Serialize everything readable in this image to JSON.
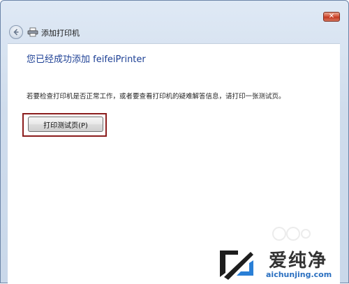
{
  "window": {
    "close_glyph": "✕"
  },
  "nav": {
    "title": "添加打印机"
  },
  "content": {
    "heading": "您已经成功添加 feifeiPrinter",
    "body": "若要检查打印机是否正常工作，或者要查看打印机的疑难解答信息，请打印一张测试页。",
    "print_test_button": "打印测试页(P)"
  },
  "watermark": {
    "text_cn": "爱纯净",
    "url": "aichunjing.com"
  },
  "icons": {
    "back": "back-arrow-icon",
    "printer": "printer-icon",
    "close": "close-icon"
  },
  "colors": {
    "heading": "#1c3f94",
    "highlight": "#8b1d1d",
    "close": "#c23a22"
  }
}
